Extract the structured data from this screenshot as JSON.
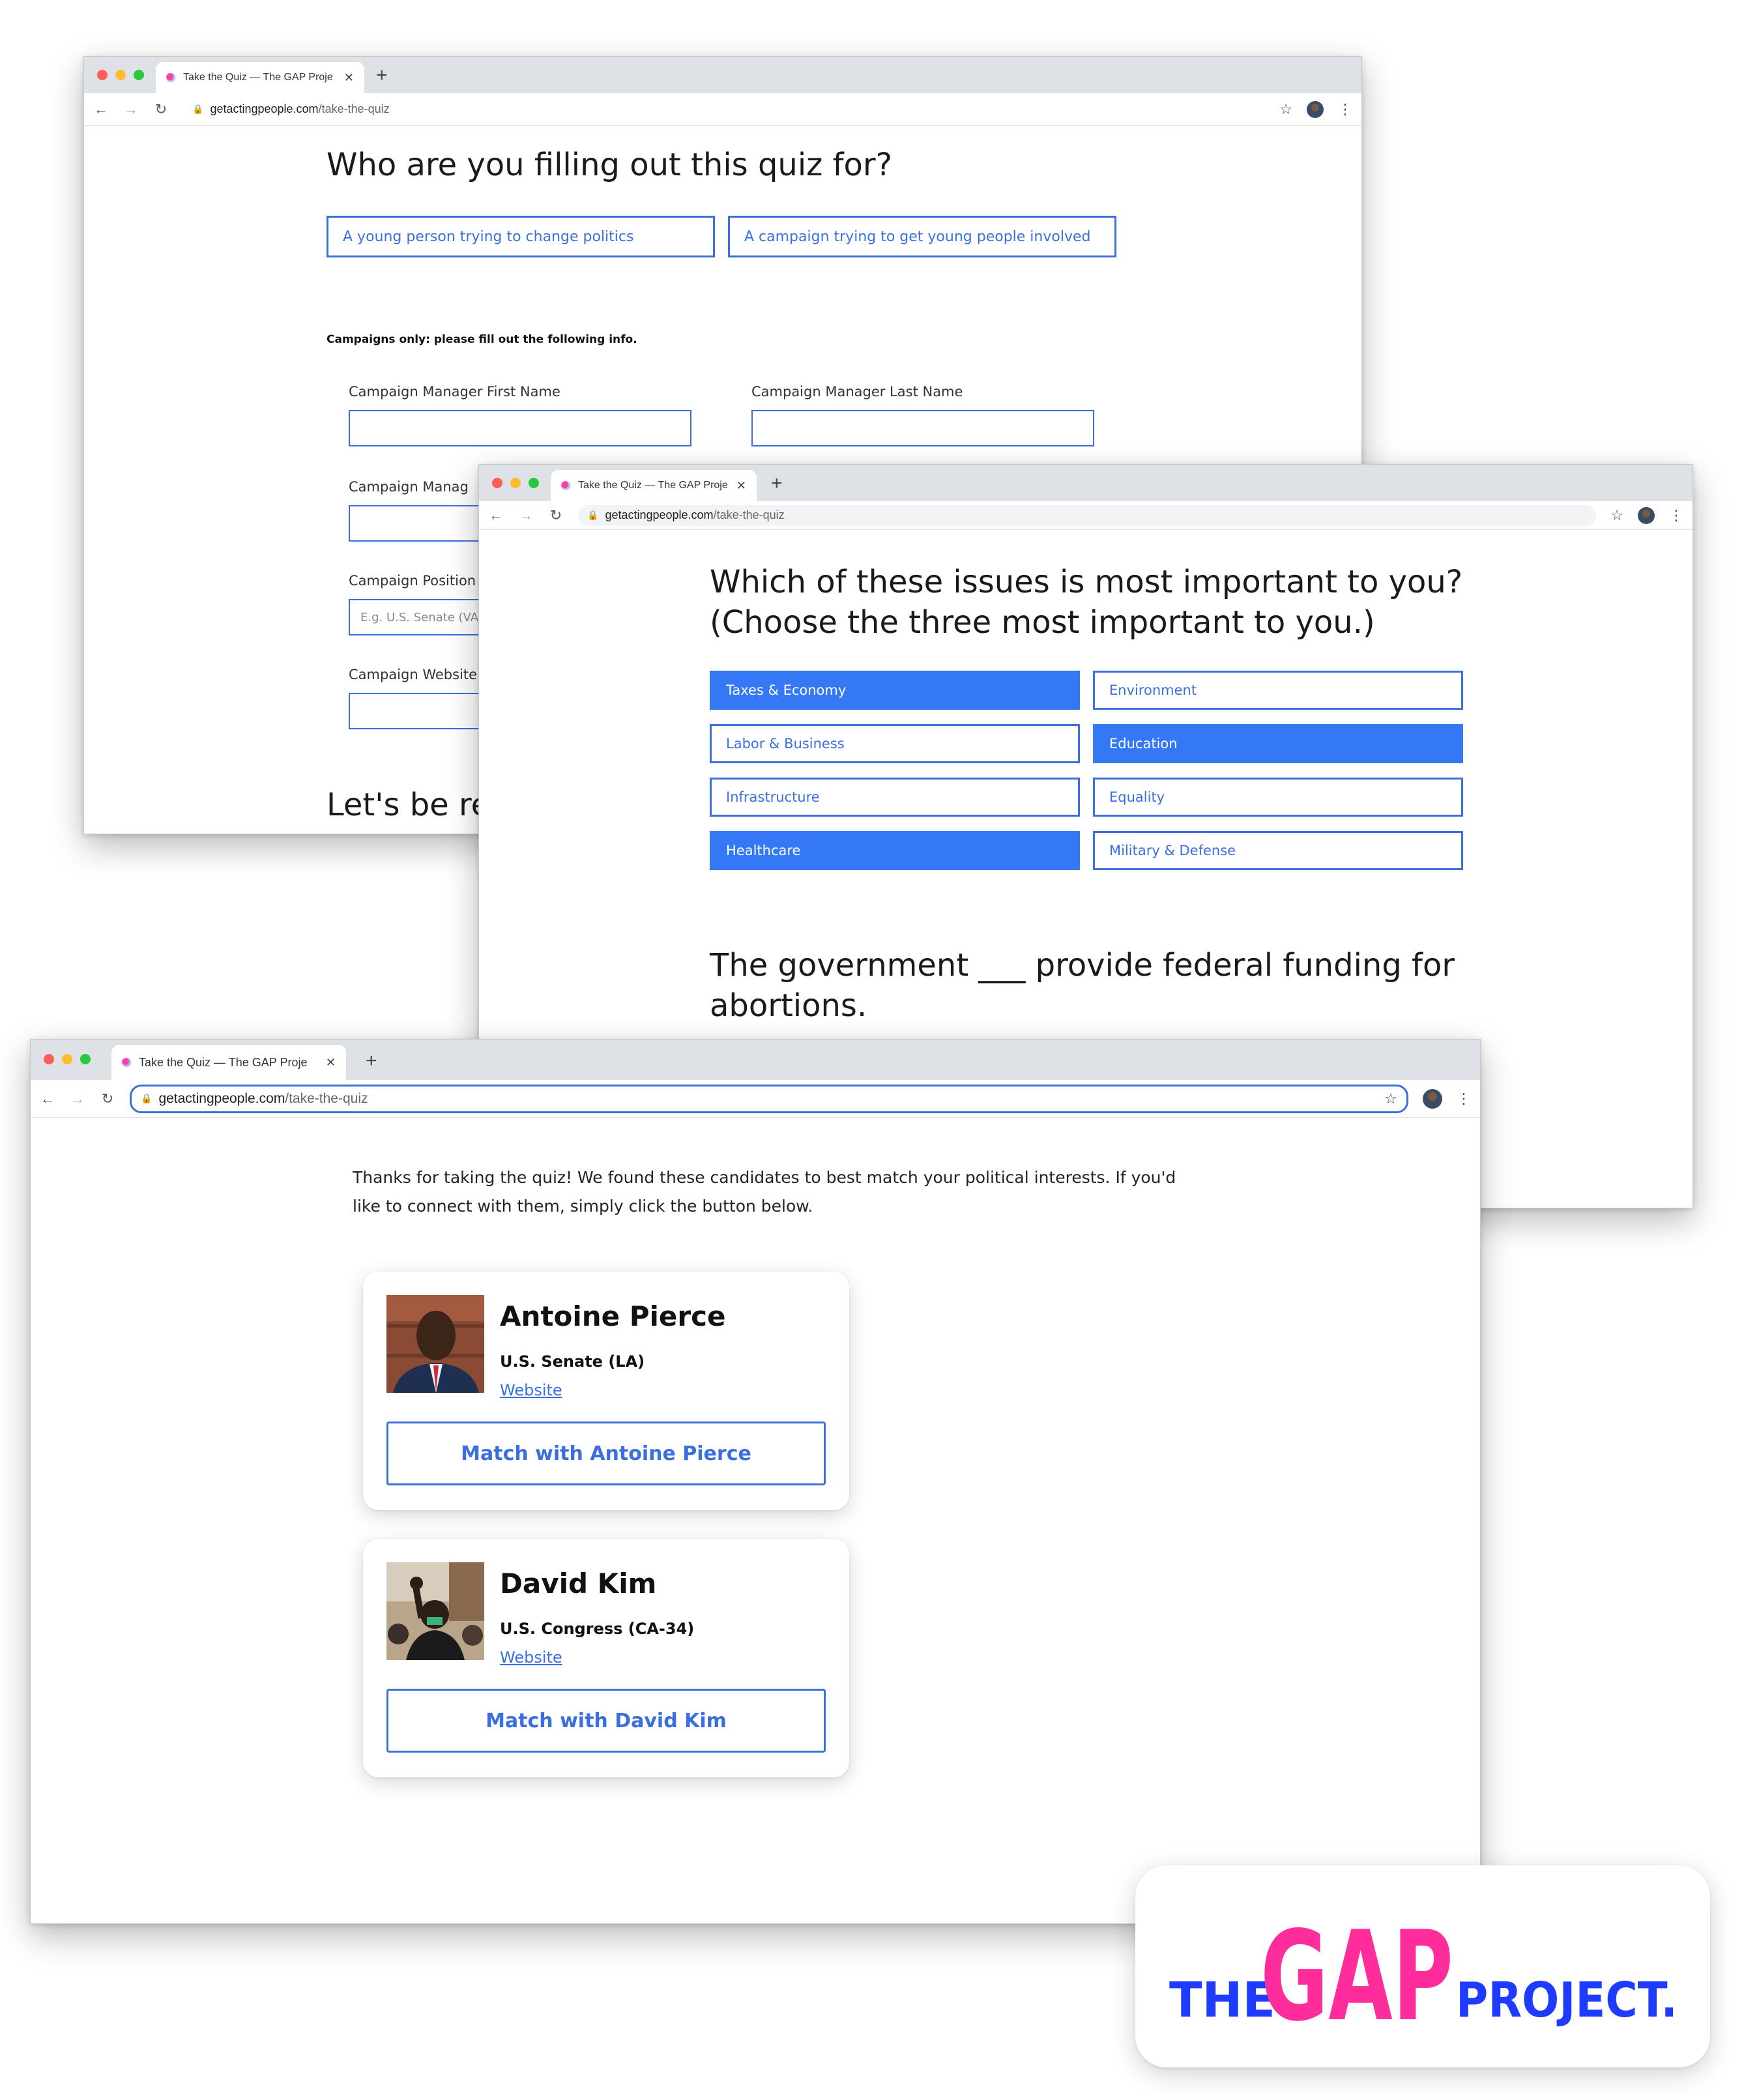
{
  "browser": {
    "tab_title": "Take the Quiz — The GAP Proje",
    "url_domain": "getactingpeople.com",
    "url_path": "/take-the-quiz"
  },
  "window1": {
    "question": "Who are you filling out this quiz for?",
    "options": [
      "A young person trying to change politics",
      "A campaign trying to get young people involved"
    ],
    "campaigns_note": "Campaigns only: please fill out the following info.",
    "fields": {
      "first_name_label": "Campaign Manager First Name",
      "last_name_label": "Campaign Manager Last Name",
      "manager_label": "Campaign Manag",
      "position_label": "Campaign Position",
      "position_placeholder": "E.g. U.S. Senate (VA",
      "website_label": "Campaign Website"
    },
    "next_heading": "Let's be re"
  },
  "window2": {
    "question_line1": "Which of these issues is most important to you?",
    "question_line2": "(Choose the three most important to you.)",
    "issues": [
      {
        "label": "Taxes & Economy",
        "selected": true
      },
      {
        "label": "Environment",
        "selected": false
      },
      {
        "label": "Labor & Business",
        "selected": false
      },
      {
        "label": "Education",
        "selected": true
      },
      {
        "label": "Infrastructure",
        "selected": false
      },
      {
        "label": "Equality",
        "selected": false
      },
      {
        "label": "Healthcare",
        "selected": true
      },
      {
        "label": "Military & Defense",
        "selected": false
      }
    ],
    "next_question_line1": "The government ___ provide federal funding for",
    "next_question_line2": "abortions."
  },
  "window3": {
    "intro_line1": "Thanks for taking the quiz! We found these candidates to best match your political interests. If you'd",
    "intro_line2": "like to connect with them, simply click the button below.",
    "candidates": [
      {
        "name": "Antoine Pierce",
        "role": "U.S. Senate (LA)",
        "link": "Website",
        "button": "Match with Antoine Pierce"
      },
      {
        "name": "David Kim",
        "role": "U.S. Congress (CA-34)",
        "link": "Website",
        "button": "Match with David Kim"
      }
    ]
  },
  "logo": {
    "the": "THE",
    "gap": "GAP",
    "project": "PROJECT.",
    "colors": {
      "blue": "#1f3bff",
      "pink": "#ff2c9c",
      "red": "#ff1f3d"
    }
  },
  "colors": {
    "accent": "#3b6fe0",
    "selected_fill": "#3478f6"
  }
}
